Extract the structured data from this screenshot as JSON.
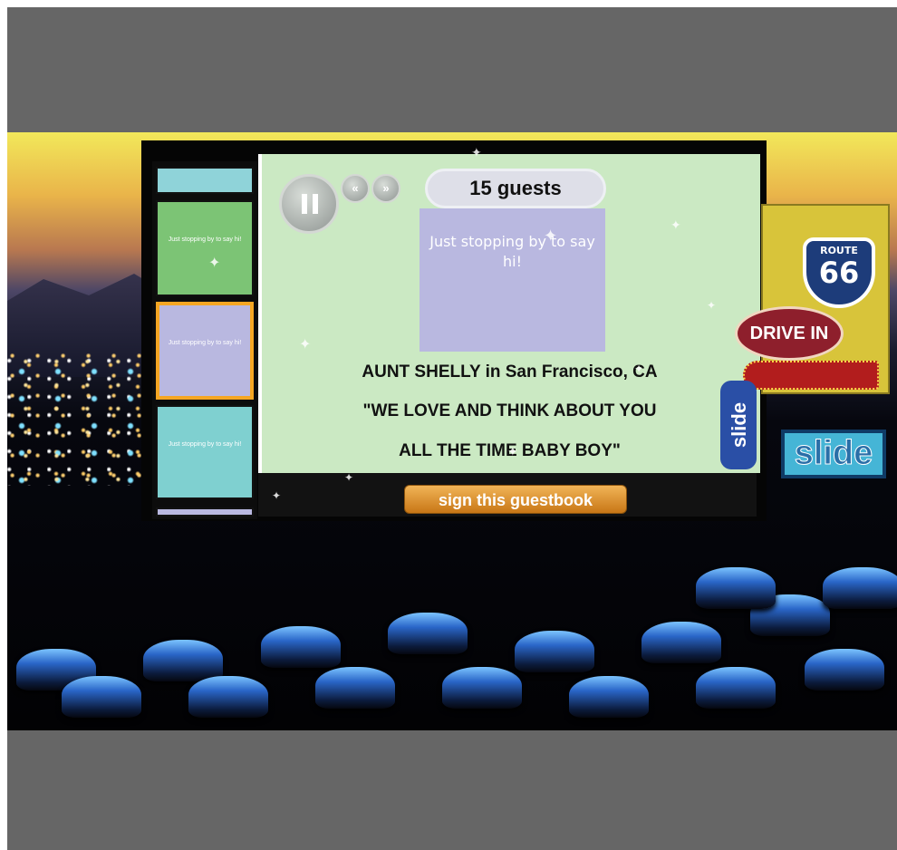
{
  "player": {
    "guest_count": "15 guests",
    "controls": {
      "pause_label": "pause",
      "prev_glyph": "«",
      "next_glyph": "»"
    }
  },
  "current_entry": {
    "card_text": "Just stopping by to say hi!",
    "author_line": "AUNT SHELLY in San Francisco, CA",
    "message_line1": "\"WE LOVE AND THINK ABOUT YOU",
    "message_line2": "ALL THE TIME BABY BOY\""
  },
  "thumbnails": [
    {
      "color": "#8fd3d9",
      "text": ""
    },
    {
      "color": "#7cc475",
      "text": "Just stopping by to say hi!"
    },
    {
      "color": "#b9b8e0",
      "text": "Just stopping by to say hi!"
    },
    {
      "color": "#7fd0d0",
      "text": "Just stopping by to say hi!"
    }
  ],
  "actions": {
    "sign_button": "sign this guestbook"
  },
  "signage": {
    "route_top": "ROUTE",
    "route_number": "66",
    "drive_in": "DRIVE IN",
    "slide_side": "slide",
    "slide_box": "slide"
  },
  "colors": {
    "screen": "#cbe9c3",
    "card": "#b9b8e0",
    "active_border": "#f5a623",
    "button": "#d98d28",
    "background_frame": "#666666"
  }
}
